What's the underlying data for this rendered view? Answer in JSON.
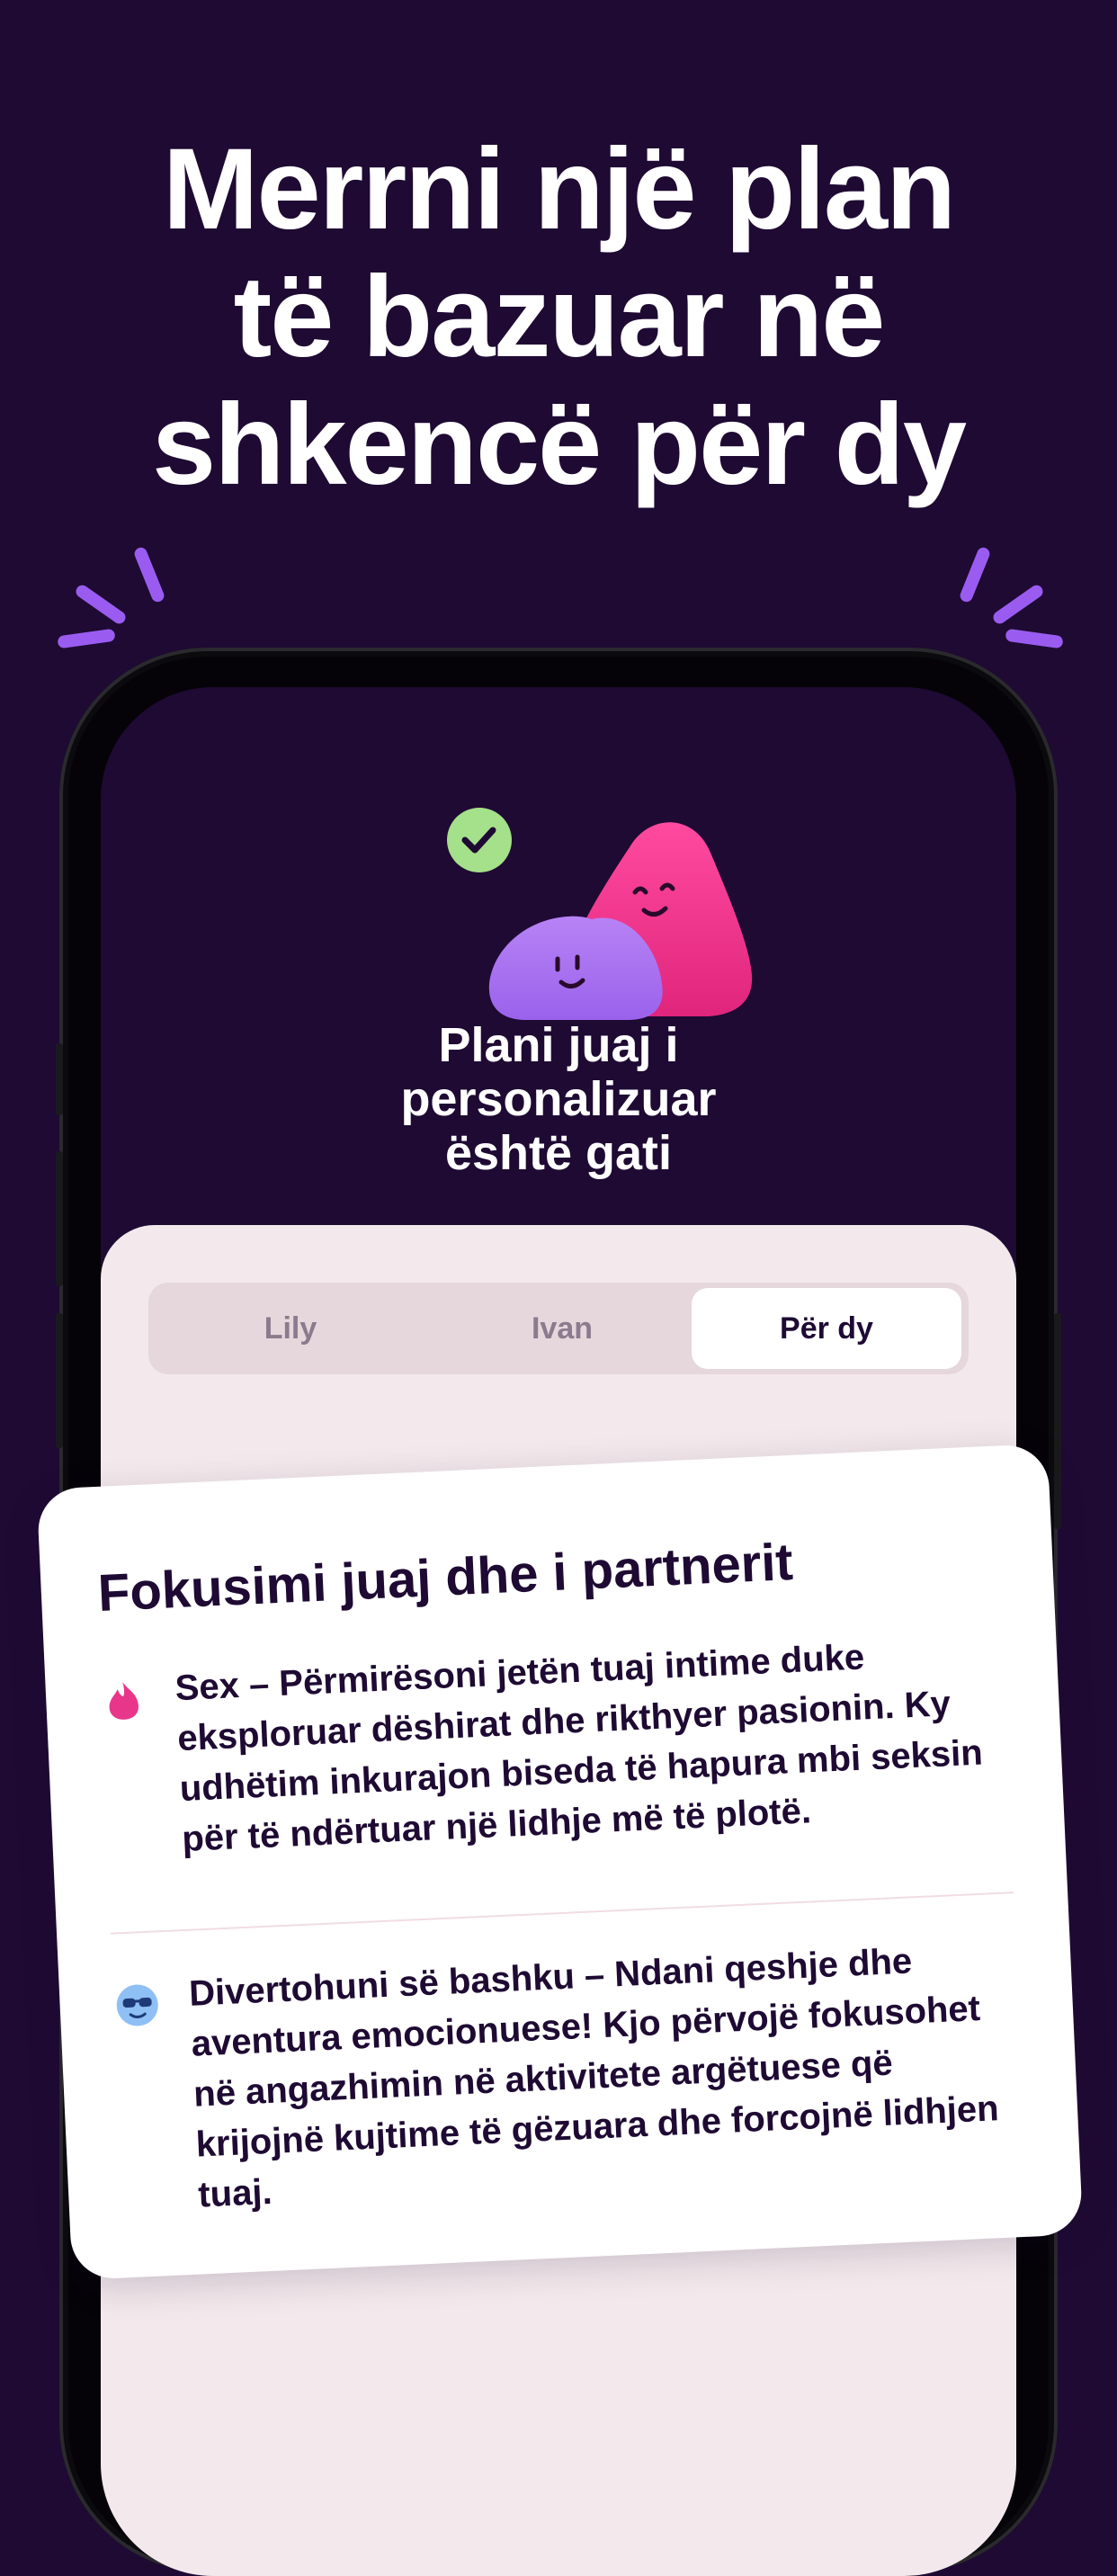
{
  "headline": {
    "lines": [
      "Merrni një plan",
      "të bazuar në",
      "shkencë për dy"
    ]
  },
  "plan": {
    "title_lines": [
      "Plani juaj i",
      "personalizuar",
      "është gati"
    ]
  },
  "tabs": [
    {
      "label": "Lily",
      "active": false
    },
    {
      "label": "Ivan",
      "active": false
    },
    {
      "label": "Për dy",
      "active": true
    }
  ],
  "focus_card": {
    "title": "Fokusimi juaj dhe i partnerit",
    "items": [
      {
        "icon": "flame-icon",
        "text": "Sex – Përmirësoni jetën tuaj intime duke eksploruar dëshirat dhe rikthyer pasionin. Ky udhëtim inkurajon biseda të hapura mbi seksin për të ndërtuar një lidhje më të plotë."
      },
      {
        "icon": "sunglasses-face-icon",
        "text": "Divertohuni së bashku – Ndani qeshje dhe aventura emocionuese! Kjo përvojë fokusohet në angazhimin në aktivitete argëtuese që krijojnë kujtime të gëzuara dhe forcojnë lidhjen tuaj."
      }
    ]
  },
  "colors": {
    "background": "#1e0a33",
    "accent_purple": "#9a5cf0",
    "blob_pink": "#e8378a",
    "blob_purple": "#a46ff0",
    "check_green": "#a5e08a",
    "sheet": "#f3e9ec"
  }
}
